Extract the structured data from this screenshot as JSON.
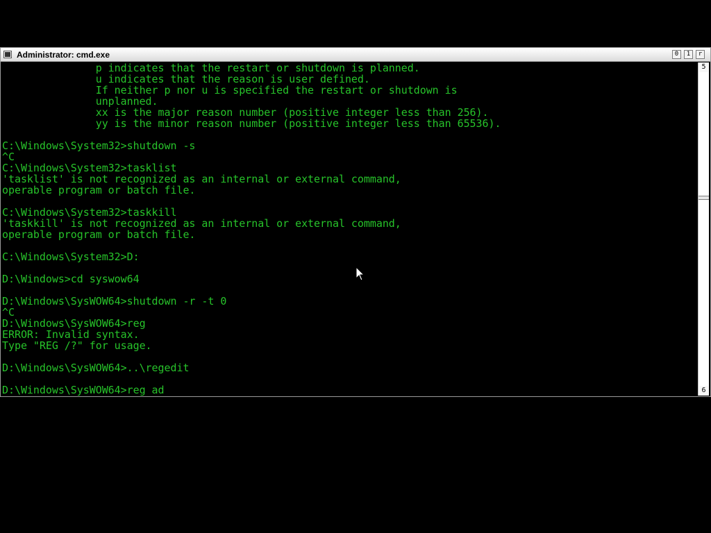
{
  "window": {
    "title": "Administrator: cmd.exe",
    "controls": {
      "minimize_glyph": "0",
      "maximize_glyph": "1",
      "close_glyph": "r"
    }
  },
  "scrollbar": {
    "up_glyph": "5",
    "down_glyph": "6",
    "thumb_position": 0.4
  },
  "colors": {
    "console_background": "#000000",
    "console_text": "#27c32a",
    "titlebar": "#e6e6e6"
  },
  "console": {
    "lines": [
      "               p indicates that the restart or shutdown is planned.",
      "               u indicates that the reason is user defined.",
      "               If neither p nor u is specified the restart or shutdown is",
      "               unplanned.",
      "               xx is the major reason number (positive integer less than 256).",
      "               yy is the minor reason number (positive integer less than 65536).",
      "",
      "C:\\Windows\\System32>shutdown -s",
      "^C",
      "C:\\Windows\\System32>tasklist",
      "'tasklist' is not recognized as an internal or external command,",
      "operable program or batch file.",
      "",
      "C:\\Windows\\System32>taskkill",
      "'taskkill' is not recognized as an internal or external command,",
      "operable program or batch file.",
      "",
      "C:\\Windows\\System32>D:",
      "",
      "D:\\Windows>cd syswow64",
      "",
      "D:\\Windows\\SysWOW64>shutdown -r -t 0",
      "^C",
      "D:\\Windows\\SysWOW64>reg",
      "ERROR: Invalid syntax.",
      "Type \"REG /?\" for usage.",
      "",
      "D:\\Windows\\SysWOW64>..\\regedit",
      "",
      "D:\\Windows\\SysWOW64>reg ad"
    ]
  }
}
